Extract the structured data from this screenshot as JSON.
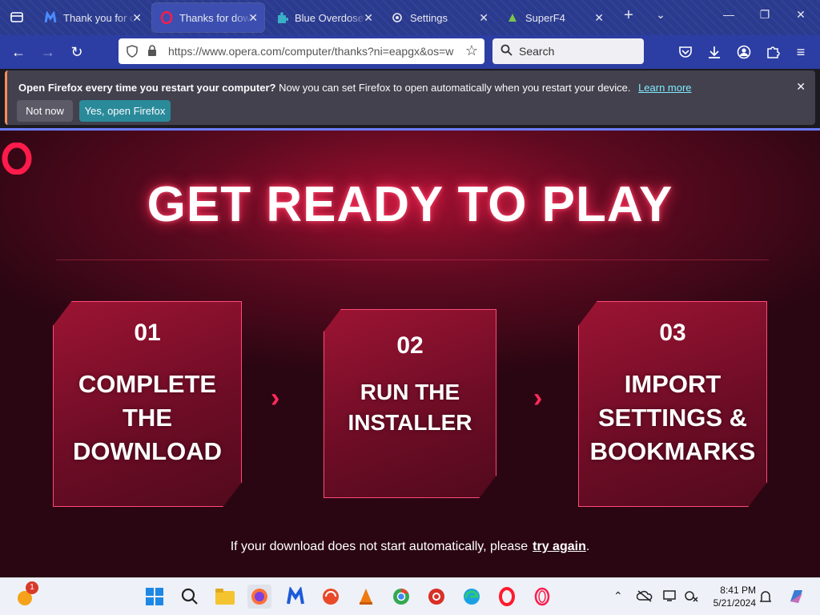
{
  "tabs": [
    {
      "label": "Thank you for d",
      "icon": "malwarebytes-icon",
      "active": false
    },
    {
      "label": "Thanks for dow",
      "icon": "opera-icon",
      "active": true
    },
    {
      "label": "Blue Overdose",
      "icon": "puzzle-icon",
      "active": false
    },
    {
      "label": "Settings",
      "icon": "gear-icon",
      "active": false
    },
    {
      "label": "SuperF4",
      "icon": "superf4-icon",
      "active": false
    }
  ],
  "address": {
    "url": "https://www.opera.com/computer/thanks?ni=eapgx&os=w"
  },
  "search": {
    "placeholder": "Search"
  },
  "notification": {
    "bold": "Open Firefox every time you restart your computer?",
    "text": "Now you can set Firefox to open automatically when you restart your device.",
    "link": "Learn more",
    "not_now": "Not now",
    "yes": "Yes, open Firefox"
  },
  "page": {
    "headline": "GET READY TO PLAY",
    "steps": [
      {
        "number": "01",
        "title": [
          "COMPLETE",
          "THE",
          "DOWNLOAD"
        ]
      },
      {
        "number": "02",
        "title": [
          "RUN THE",
          "INSTALLER"
        ]
      },
      {
        "number": "03",
        "title": [
          "IMPORT",
          "SETTINGS &",
          "BOOKMARKS"
        ]
      }
    ],
    "footer": "If your download does not start automatically, please",
    "retry": "try again",
    "period": "."
  },
  "taskbar": {
    "badge": "1",
    "time": "8:41 PM",
    "date": "5/21/2024"
  },
  "colors": {
    "accent": "#ff2a56",
    "tab_bar": "#2a3a8f",
    "nav_bar": "#2c3ea3",
    "notify_bg": "#42414d",
    "teal_button": "#2a8a9a"
  }
}
